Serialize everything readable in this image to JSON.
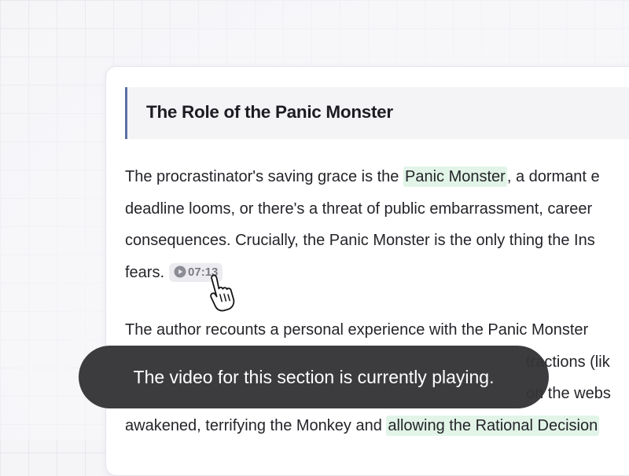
{
  "section": {
    "title": "The Role of the Panic Monster"
  },
  "paragraph1": {
    "line1_pre": "The procrastinator's saving grace is the ",
    "line1_highlight": "Panic Monster",
    "line1_post": ", a dormant e",
    "line2": "deadline looms, or there's a threat of public embarrassment, career",
    "line3": "consequences. Crucially, the Panic Monster is the only thing the Ins",
    "line4": "fears.",
    "timestamp": "07:13"
  },
  "paragraph2": {
    "line1": "The author recounts a personal experience with the Panic Monster",
    "line2_tail": "tractions (lik",
    "line3_tail": "on the webs",
    "line4_pre": "awakened, terrifying the Monkey and ",
    "line4_highlight": "allowing the Rational Decision"
  },
  "toast": {
    "message": "The video for this section is currently playing."
  },
  "icons": {
    "timestamp": "play-circle-icon",
    "cursor": "hand-pointer-icon"
  },
  "colors": {
    "highlight": "#e1f4e7",
    "header_accent": "#5b6fa3",
    "toast_bg": "#343437"
  }
}
